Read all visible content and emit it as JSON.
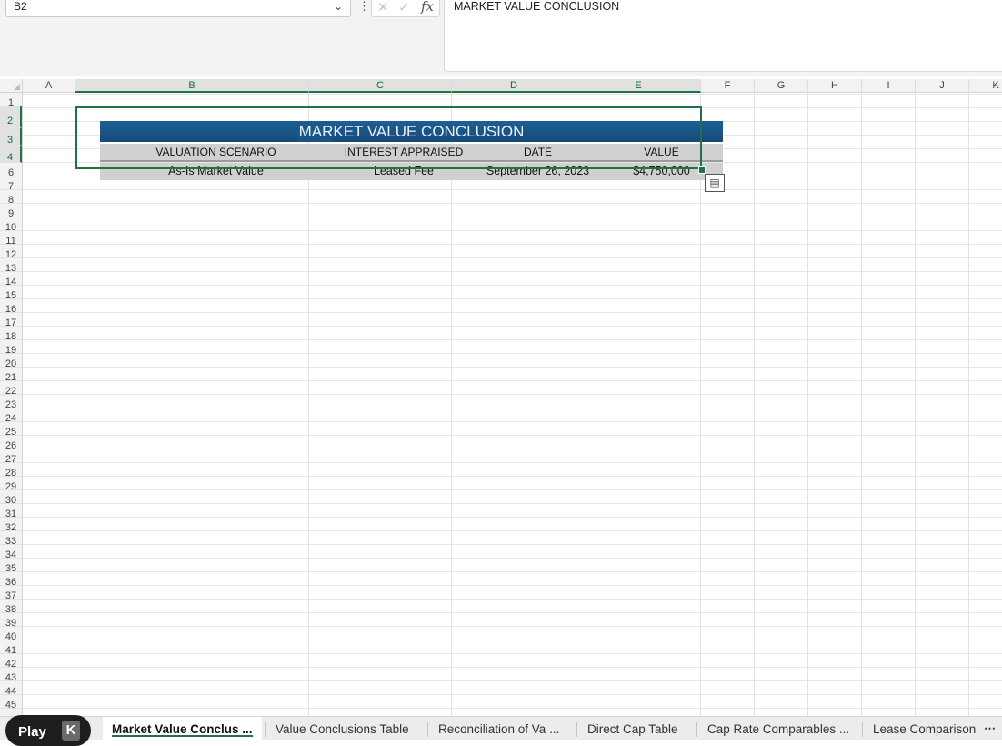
{
  "formula_bar": {
    "name_box": "B2",
    "formula": "MARKET VALUE CONCLUSION",
    "fx_label": "fx"
  },
  "columns": [
    "A",
    "B",
    "C",
    "D",
    "E",
    "F",
    "G",
    "H",
    "I",
    "J",
    "K"
  ],
  "selected_columns": [
    "B",
    "C",
    "D",
    "E"
  ],
  "rows": [
    "1",
    "2",
    "3",
    "4",
    "6",
    "7",
    "8",
    "9",
    "10",
    "11",
    "12",
    "13",
    "14",
    "15",
    "16",
    "17",
    "18",
    "19",
    "20",
    "21",
    "22",
    "23",
    "24",
    "25",
    "26",
    "27",
    "28",
    "29",
    "30",
    "31",
    "32",
    "33",
    "34",
    "35",
    "36",
    "37",
    "38",
    "39",
    "40",
    "41",
    "42",
    "43",
    "44",
    "45"
  ],
  "selected_rows": [
    "2",
    "3",
    "4"
  ],
  "table": {
    "title": "MARKET VALUE CONCLUSION",
    "headers": [
      "VALUATION SCENARIO",
      "INTEREST APPRAISED",
      "DATE",
      "VALUE"
    ],
    "row": [
      "As-Is Market Value",
      "Leased Fee",
      "September 26, 2023",
      "$4,750,000"
    ]
  },
  "sheet_tabs": [
    {
      "label": "Market Value Conclus ...",
      "active": true
    },
    {
      "label": "Value Conclusions Table",
      "active": false
    },
    {
      "label": "Reconciliation of Va ...",
      "active": false
    },
    {
      "label": "Direct Cap Table",
      "active": false
    },
    {
      "label": "Cap Rate Comparables ...",
      "active": false
    },
    {
      "label": "Lease Comparison",
      "active": false
    }
  ],
  "overlay": {
    "play_label": "Play",
    "play_key": "K"
  },
  "colors": {
    "accent": "#217346",
    "title_fill": "#1a5385",
    "header_fill": "#d0d0d0"
  }
}
